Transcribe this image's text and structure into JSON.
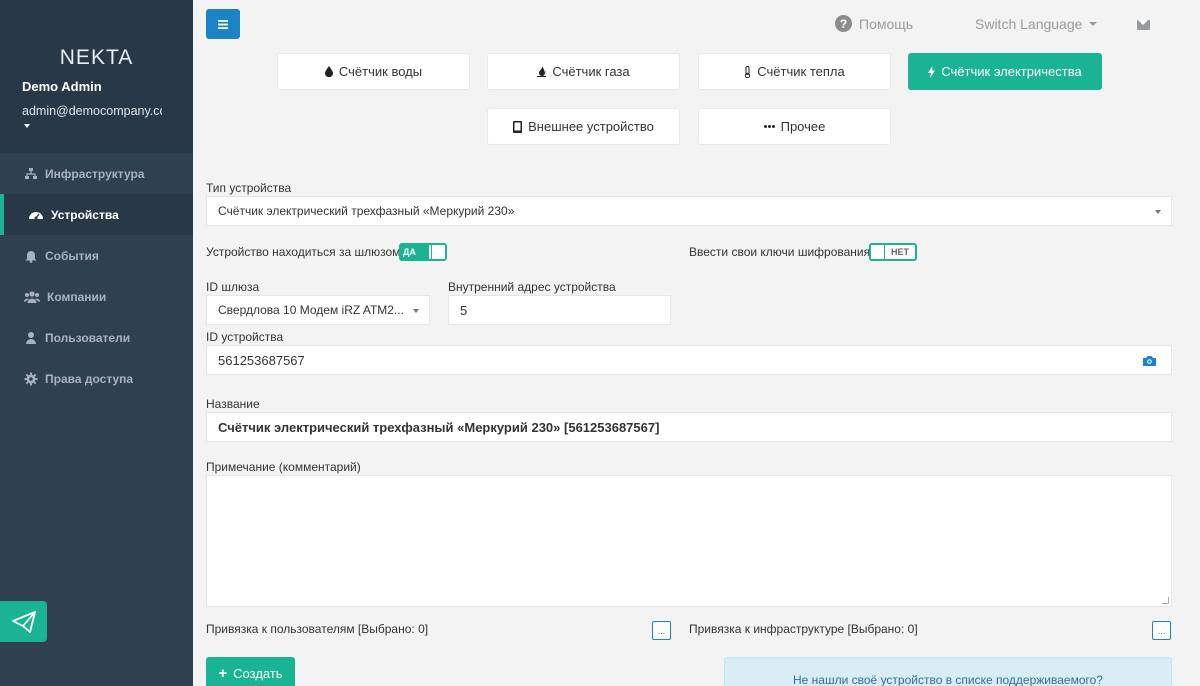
{
  "sidebar": {
    "brand": "NEKTA",
    "user_name": "Demo Admin",
    "user_email": "admin@democompany.com",
    "items": [
      {
        "label": "Инфраструктура",
        "icon": "sitemap-icon"
      },
      {
        "label": "Устройства",
        "icon": "dashboard-icon",
        "active": true
      },
      {
        "label": "События",
        "icon": "bell-icon"
      },
      {
        "label": "Компании",
        "icon": "users-icon"
      },
      {
        "label": "Пользователи",
        "icon": "user-icon"
      },
      {
        "label": "Права доступа",
        "icon": "cog-icon"
      }
    ]
  },
  "topbar": {
    "help_label": "Помощь",
    "language_label": "Switch Language"
  },
  "device_types": [
    {
      "label": "Счётчик воды",
      "icon": "tint-icon"
    },
    {
      "label": "Счётчик газа",
      "icon": "fire-icon"
    },
    {
      "label": "Счётчик тепла",
      "icon": "thermometer-icon"
    },
    {
      "label": "Счётчик электричества",
      "icon": "bolt-icon",
      "active": true
    },
    {
      "label": "Внешнее устройство",
      "icon": "tablet-icon"
    },
    {
      "label": "Прочее",
      "icon": "ellipsis-icon"
    }
  ],
  "form": {
    "device_type_label": "Тип устройства",
    "device_type_value": "Счётчик электрический трехфазный «Меркурий 230»",
    "behind_gateway_label": "Устройство находиться за шлюзом",
    "behind_gateway_toggle": "ДА",
    "own_keys_label": "Ввести свои ключи шифрования",
    "own_keys_toggle": "НЕТ",
    "gateway_id_label": "ID шлюза",
    "gateway_id_value": "Свердлова 10 Модем iRZ ATM2...",
    "internal_address_label": "Внутренний адрес устройства",
    "internal_address_value": "5",
    "device_id_label": "ID устройства",
    "device_id_value": "561253687567",
    "name_label": "Название",
    "name_value": "Счётчик электрический трехфазный «Меркурий 230» [561253687567]",
    "comment_label": "Примечание (комментарий)",
    "comment_value": "",
    "users_binding_label": "Привязка к пользователям [Выбрано: 0]",
    "infra_binding_label": "Привязка к инфраструктуре [Выбрано: 0]",
    "dots_label": "...",
    "create_label": "Создать",
    "not_found_text": "Не нашли своё устройство в списке поддерживаемого?"
  },
  "colors": {
    "accent": "#1ab394",
    "primary": "#1c84c6",
    "sidebar": "#2f4050"
  }
}
